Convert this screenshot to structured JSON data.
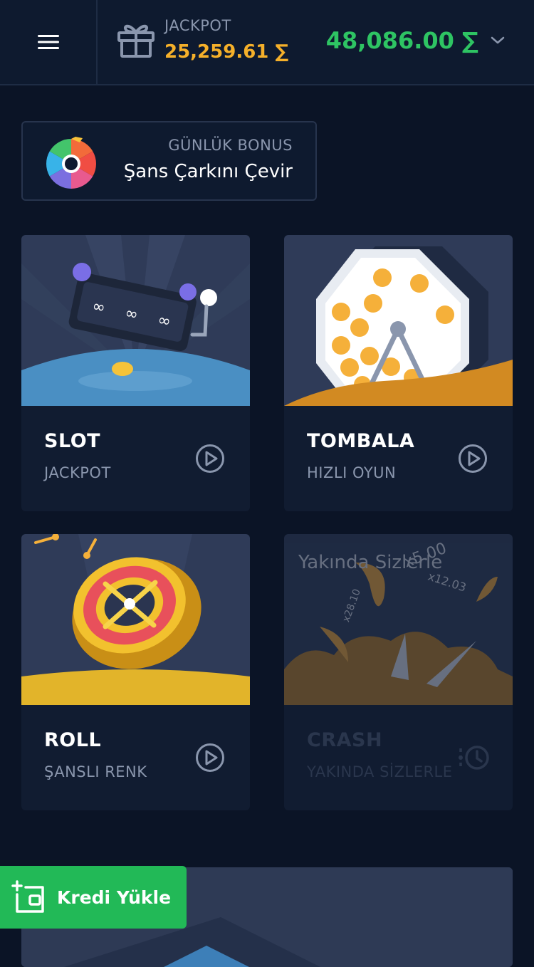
{
  "header": {
    "menu_icon": "hamburger-menu-icon",
    "gift_icon": "gift-icon",
    "jackpot_label": "JACKPOT",
    "jackpot_value": "25,259.61 ∑",
    "balance": "48,086.00 ∑",
    "balance_icon": "chevron-down-icon"
  },
  "bonus": {
    "icon": "color-wheel-icon",
    "label": "GÜNLÜK BONUS",
    "title": "Şans Çarkını Çevir"
  },
  "games": [
    {
      "title": "SLOT",
      "subtitle": "JACKPOT",
      "action_icon": "play-circle-icon"
    },
    {
      "title": "TOMBALA",
      "subtitle": "HIZLI OYUN",
      "action_icon": "play-circle-icon"
    },
    {
      "title": "ROLL",
      "subtitle": "ŞANSLI RENK",
      "action_icon": "play-circle-icon"
    },
    {
      "title": "CRASH",
      "subtitle": "YAKINDA SİZLERLE",
      "action_icon": "clock-history-icon",
      "art_overlay": "Yakında Sizlerle",
      "multipliers": [
        "x5.00",
        "x12.03",
        "x28.10"
      ]
    }
  ],
  "fab": {
    "icon": "wallet-add-icon",
    "label": "Kredi Yükle"
  },
  "colors": {
    "background": "#0b1426",
    "header": "#0e1a2f",
    "jackpot": "#f5b02a",
    "balance": "#2ec463",
    "fab": "#22b957",
    "muted": "#8a96ad"
  }
}
